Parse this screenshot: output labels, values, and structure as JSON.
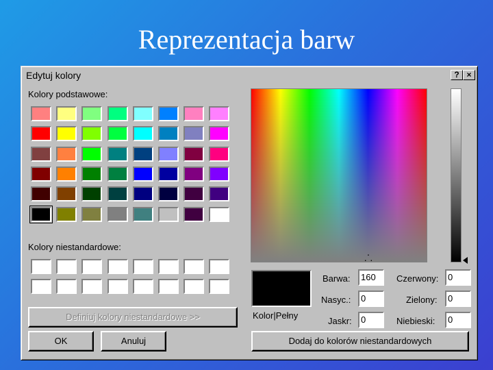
{
  "slide": {
    "title": "Reprezentacja barw"
  },
  "dialog": {
    "title": "Edytuj kolory",
    "help_label": "?",
    "close_label": "×",
    "basic_colors_label": "Kolory podstawowe:",
    "basic_colors": [
      "#ff8080",
      "#ffff80",
      "#80ff80",
      "#00ff80",
      "#80ffff",
      "#0080ff",
      "#ff80c0",
      "#ff80ff",
      "#ff0000",
      "#ffff00",
      "#80ff00",
      "#00ff40",
      "#00ffff",
      "#0080c0",
      "#8080c0",
      "#ff00ff",
      "#804040",
      "#ff8040",
      "#00ff00",
      "#008080",
      "#004080",
      "#8080ff",
      "#800040",
      "#ff0080",
      "#800000",
      "#ff8000",
      "#008000",
      "#008040",
      "#0000ff",
      "#0000a0",
      "#800080",
      "#8000ff",
      "#400000",
      "#804000",
      "#004000",
      "#004040",
      "#000080",
      "#000040",
      "#400040",
      "#400080",
      "#000000",
      "#808000",
      "#808040",
      "#808080",
      "#408080",
      "#c0c0c0",
      "#400040",
      "#ffffff"
    ],
    "selected_basic_index": 40,
    "custom_colors_label": "Kolory niestandardowe:",
    "custom_colors": [
      "#ffffff",
      "#ffffff",
      "#ffffff",
      "#ffffff",
      "#ffffff",
      "#ffffff",
      "#ffffff",
      "#ffffff",
      "#ffffff",
      "#ffffff",
      "#ffffff",
      "#ffffff",
      "#ffffff",
      "#ffffff",
      "#ffffff",
      "#ffffff"
    ],
    "define_custom_button": "Definiuj kolory niestandardowe >>",
    "ok_button": "OK",
    "cancel_button": "Anuluj",
    "solid_color_label": "Kolor|Pełny",
    "hue_label": "Barwa:",
    "hue_value": "160",
    "sat_label": "Nasyc.:",
    "sat_value": "0",
    "lum_label": "Jaskr:",
    "lum_value": "0",
    "red_label": "Czerwony:",
    "red_value": "0",
    "green_label": "Zielony:",
    "green_value": "0",
    "blue_label": "Niebieski:",
    "blue_value": "0",
    "add_custom_button": "Dodaj do kolorów niestandardowych",
    "current_color": "#000000"
  }
}
